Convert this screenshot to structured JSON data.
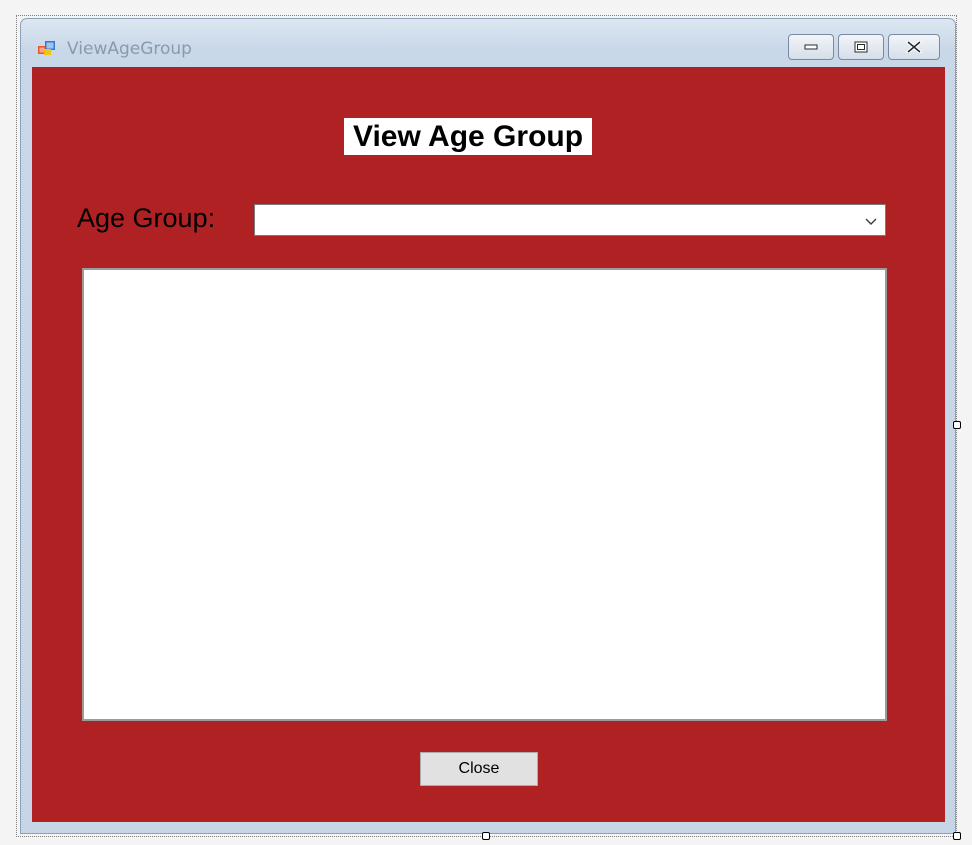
{
  "window": {
    "title": "ViewAgeGroup",
    "icon": "windows-form-icon",
    "buttons": {
      "minimize_icon": "minimize-icon",
      "maximize_icon": "maximize-icon",
      "close_icon": "close-icon"
    }
  },
  "form": {
    "heading": "View Age Group",
    "age_group_label": "Age Group:",
    "age_group_value": "",
    "list_items": [],
    "close_button_label": "Close"
  },
  "colors": {
    "form_background": "#b02123",
    "heading_background": "#ffffff",
    "button_background": "#e1e1e1"
  }
}
